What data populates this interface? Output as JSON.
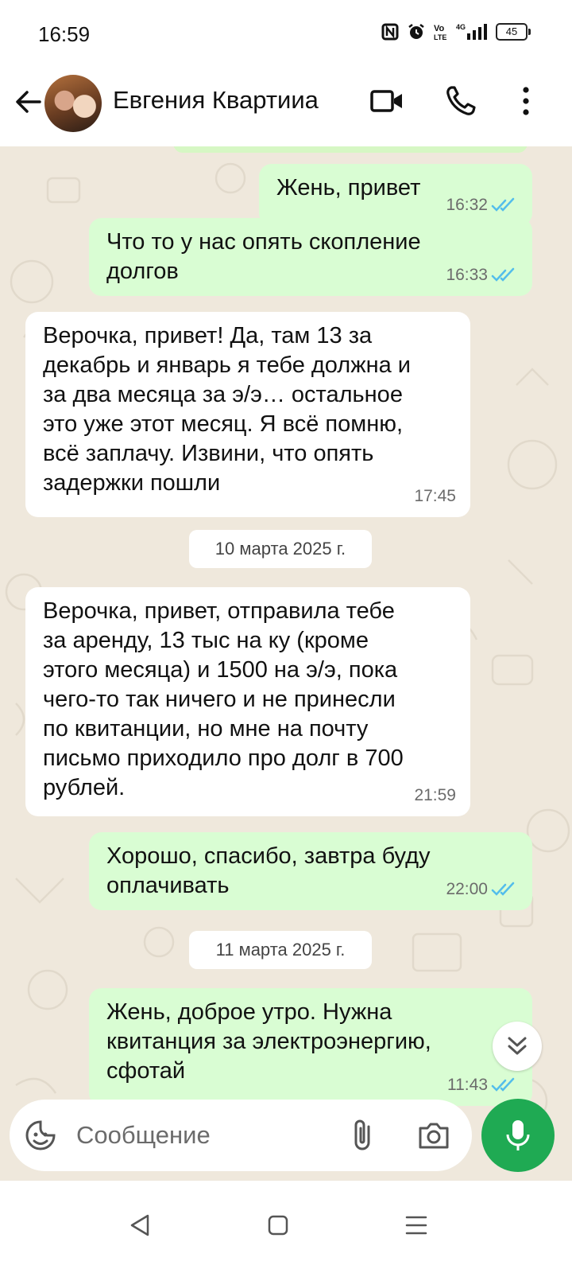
{
  "status_bar": {
    "time": "16:59",
    "indicators": [
      "nfc-icon",
      "alarm-icon",
      "volte-icon",
      "signal-4g-icon"
    ],
    "battery": "45"
  },
  "header": {
    "contact_name": "Евгения Квартииа",
    "icons": [
      "back-arrow-icon",
      "video-call-icon",
      "phone-icon",
      "more-icon"
    ]
  },
  "messages": [
    {
      "dir": "out",
      "text": "Жень, привет",
      "time": "16:32",
      "read": true
    },
    {
      "dir": "out",
      "text": "Что то у  нас опять скопление\nдолгов",
      "time": "16:33",
      "read": true
    },
    {
      "dir": "in",
      "text": "Верочка, привет! Да, там 13 за\nдекабрь и январь я тебе должна и\nза два месяца за э/э… остальное\nэто уже этот месяц. Я всё помню,\nвсё заплачу. Извини, что опять\nзадержки пошли",
      "time": "17:45"
    },
    {
      "dir": "date",
      "text": "10 марта 2025 г."
    },
    {
      "dir": "in",
      "text": "Верочка, привет, отправила тебе\nза аренду, 13 тыс на ку (кроме\nэтого месяца) и 1500 на э/э, пока\nчего-то так ничего и не принесли\nпо квитанции, но мне на почту\nписьмо приходило про долг в 700\nрублей.",
      "time": "21:59"
    },
    {
      "dir": "out",
      "text": "Хорошо, спасибо, завтра буду\nоплачивать",
      "time": "22:00",
      "read": true
    },
    {
      "dir": "date",
      "text": "11 марта 2025 г."
    },
    {
      "dir": "out",
      "text": "Жень, доброе утро. Нужна\nквитанция за электроэнергию,\nсфотай",
      "time": "11:43",
      "read": true
    }
  ],
  "composer": {
    "placeholder": "Сообщение",
    "icons": [
      "sticker-icon",
      "attach-icon",
      "camera-icon",
      "mic-icon"
    ]
  },
  "nav_bar": {
    "icons": [
      "nav-back-icon",
      "nav-home-icon",
      "nav-recents-icon"
    ]
  },
  "colors": {
    "outgoing_bubble": "#d9fdd3",
    "incoming_bubble": "#ffffff",
    "chat_background": "#efe8dc",
    "read_ticks": "#53bdeb",
    "mic_button": "#1faa53"
  }
}
